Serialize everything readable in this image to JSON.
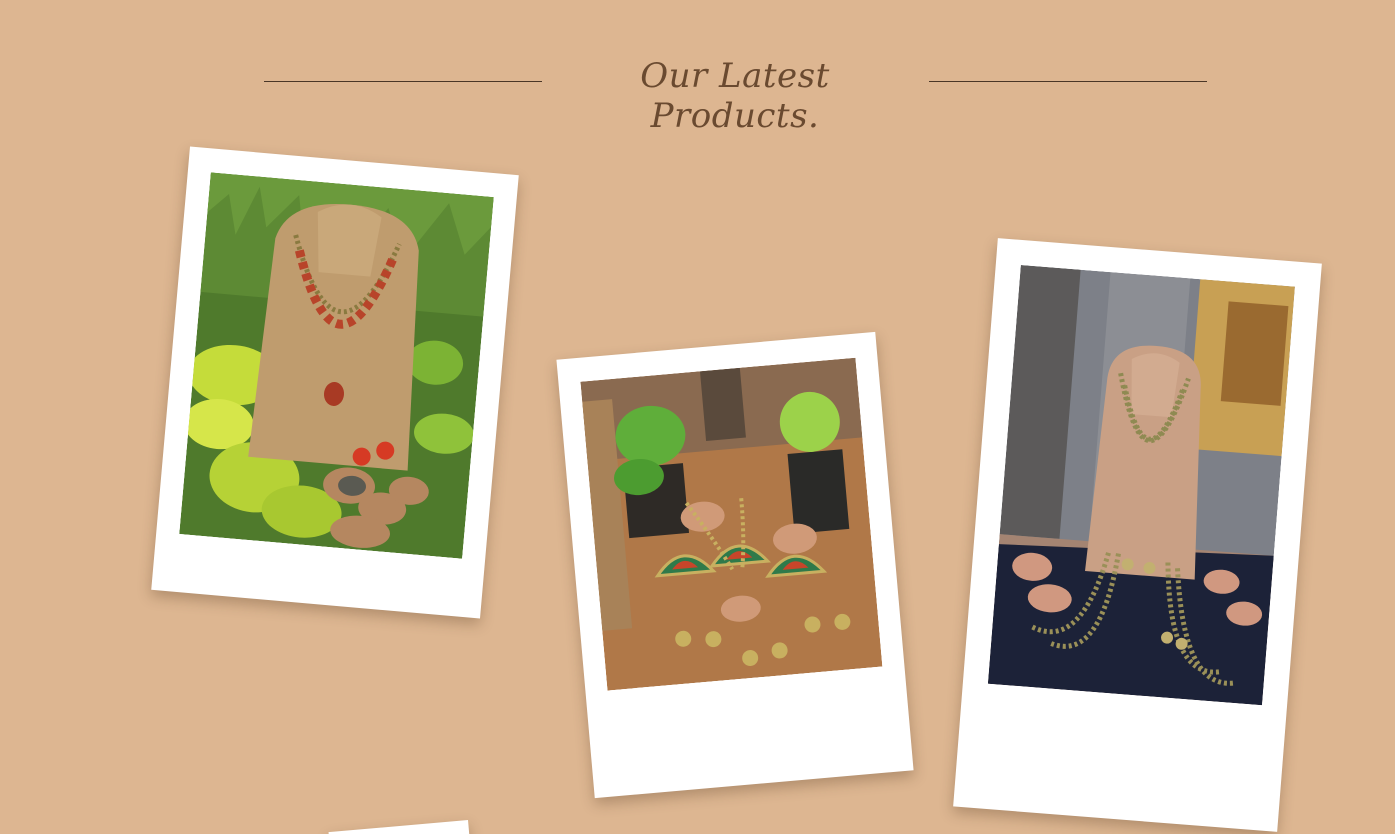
{
  "section": {
    "title": "Our Latest Products."
  },
  "products": [
    {
      "image_alt": "Terracotta necklace with red pendants and matching earrings on a jute bust stand among green plants"
    },
    {
      "image_alt": "Terracotta fan-shaped earrings in green and red with beaded strands among potted plants"
    },
    {
      "image_alt": "Layered olive bead terracotta necklace with matching earrings on a jute bust stand over navy cloth"
    }
  ],
  "colors": {
    "background": "#ddb691",
    "title": "#6a4a30",
    "rule": "#4a3626",
    "card": "#ffffff"
  }
}
